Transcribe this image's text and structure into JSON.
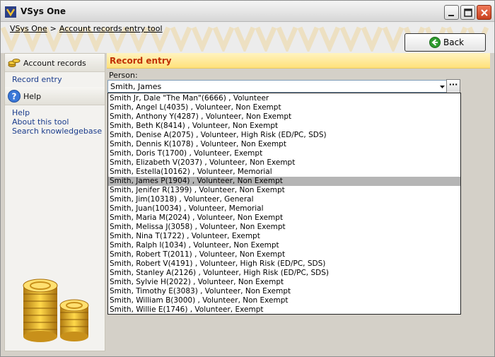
{
  "window": {
    "title": "VSys One"
  },
  "breadcrumb": {
    "home": "VSys One",
    "separator": ">",
    "current": "Account records entry tool"
  },
  "toolbar": {
    "back_label": "Back"
  },
  "sidebar": {
    "account_section": {
      "label": "Account records",
      "icon": "coins-icon"
    },
    "account_items": [
      {
        "label": "Record entry"
      }
    ],
    "help_section": {
      "label": "Help",
      "icon": "help-icon"
    },
    "help_items": [
      {
        "label": "Help"
      },
      {
        "label": "About this tool"
      },
      {
        "label": "Search knowledgebase"
      }
    ]
  },
  "main": {
    "section_title": "Record entry",
    "person_label": "Person:",
    "person_value": "Smith, James",
    "ellipsis_label": "···",
    "options": [
      "Smith Jr, Dale \"The Man\"(6666) , Volunteer",
      "Smith, Angel L(4035) , Volunteer, Non Exempt",
      "Smith, Anthony Y(4287) , Volunteer, Non Exempt",
      "Smith, Beth K(8414) , Volunteer, Non Exempt",
      "Smith, Denise A(2075) , Volunteer, High Risk (ED/PC, SDS)",
      "Smith, Dennis K(1078) , Volunteer, Non Exempt",
      "Smith, Doris T(1700) , Volunteer, Exempt",
      "Smith, Elizabeth V(2037) , Volunteer, Non Exempt",
      "Smith, Estella(10162) , Volunteer, Memorial",
      "Smith, James P(1904) , Volunteer, Non Exempt",
      "Smith, Jenifer R(1399) , Volunteer, Non Exempt",
      "Smith, Jim(10318) , Volunteer, General",
      "Smith, Juan(10034) , Volunteer, Memorial",
      "Smith, Maria M(2024) , Volunteer, Non Exempt",
      "Smith, Melissa J(3058) , Volunteer, Non Exempt",
      "Smith, Nina T(1722) , Volunteer, Exempt",
      "Smith, Ralph I(1034) , Volunteer, Non Exempt",
      "Smith, Robert T(2011) , Volunteer, Non Exempt",
      "Smith, Robert V(4191) , Volunteer, High Risk (ED/PC, SDS)",
      "Smith, Stanley A(2126) , Volunteer, High Risk (ED/PC, SDS)",
      "Smith, Sylvie H(2022) , Volunteer, Non Exempt",
      "Smith, Timothy E(3083) , Volunteer, Non Exempt",
      "Smith, William B(3000) , Volunteer, Non Exempt",
      "Smith, Willie E(1746) , Volunteer, Exempt"
    ],
    "selected_index": 9
  },
  "colors": {
    "accent": "#c03000",
    "highlight": "#ffe17a",
    "selection": "#b5b5b5",
    "link": "#1a3c8c"
  }
}
